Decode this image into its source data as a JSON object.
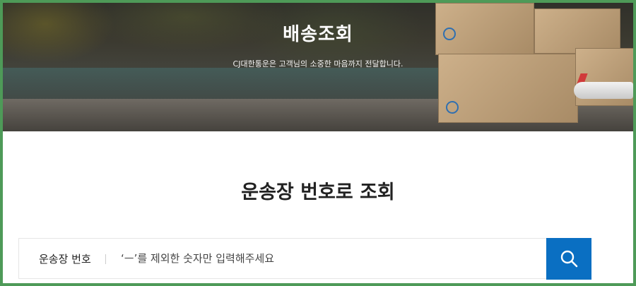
{
  "hero": {
    "title": "배송조회",
    "subtitle": "CJ대한통운은 고객님의 소중한 마음까지 전달합니다."
  },
  "main": {
    "section_title": "운송장 번호로 조회"
  },
  "search": {
    "label": "운송장 번호",
    "placeholder": "‘ㅡ’를 제외한 숫자만 입력해주세요",
    "button_icon": "search-icon",
    "button_color": "#0a6fc2"
  },
  "colors": {
    "frame": "#4e9a58",
    "accent": "#0a6fc2"
  }
}
